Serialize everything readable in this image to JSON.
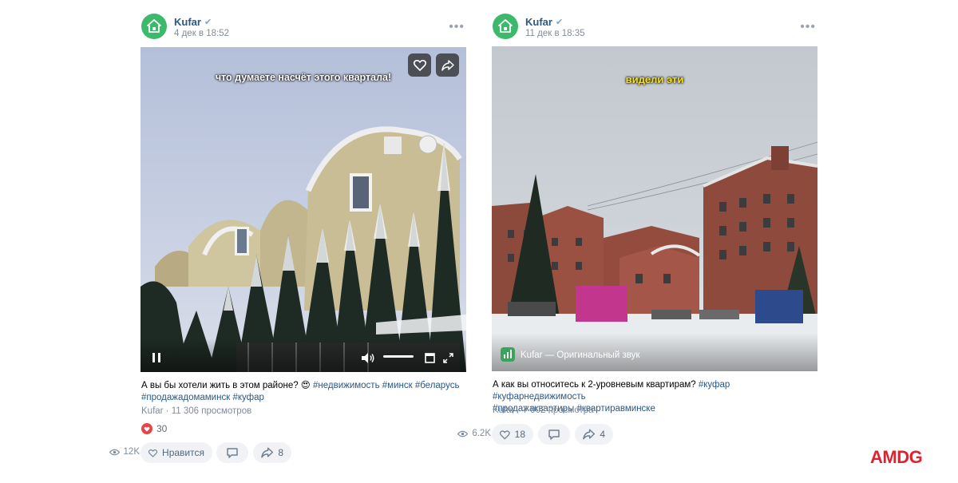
{
  "posts": [
    {
      "author": "Kufar",
      "date": "4 дек в 18:52",
      "overlay_caption": "что думаете насчёт этого квартала!",
      "text_plain": "А вы бы хотели жить в этом районе? 😍 ",
      "hashtags_line1": [
        "#недвижимость",
        "#минск",
        "#беларусь"
      ],
      "hashtags_line2": [
        "#продажадомаминск",
        "#куфар"
      ],
      "views_line": "Kufar · 11 306 просмотров",
      "reactions_count": "30",
      "like_label": "Нравится",
      "shares": "8",
      "views_short": "12K",
      "media_icons": [
        "heart-icon",
        "share-icon",
        "pause-icon",
        "volume-icon",
        "miniplayer-icon",
        "fullscreen-icon"
      ]
    },
    {
      "author": "Kufar",
      "date": "11 дек в 18:35",
      "overlay_caption": "видели эти",
      "text_plain": "А как вы относитесь к 2-уровневым квартирам? ",
      "hashtags_line1": [
        "#куфар",
        "#куфарнедвижимость"
      ],
      "hashtags_line2": [
        "#продажаквартиры",
        "#квартиравминске"
      ],
      "views_line": "Kufar · 7 902 просмотра",
      "likes": "18",
      "shares": "4",
      "views_short": "6.2K",
      "sound_label": "Kufar — Оригинальный звук"
    }
  ],
  "brand_logo": "AMDG",
  "colors": {
    "link": "#2a5885",
    "avatar": "#3cb96b",
    "reaction": "#e64646",
    "logo": "#e4202e"
  }
}
